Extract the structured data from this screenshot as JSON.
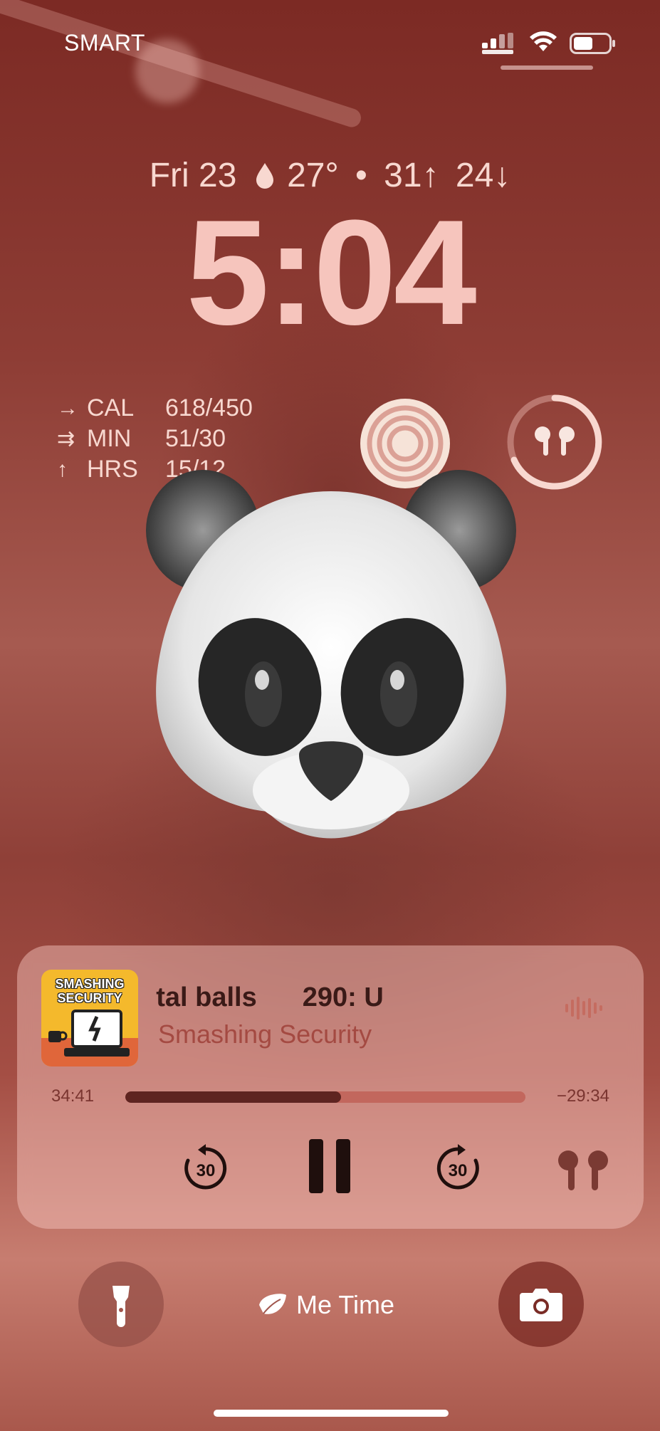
{
  "status_bar": {
    "carrier": "SMART"
  },
  "lockscreen": {
    "date": "Fri 23",
    "weather": {
      "temp": "27°",
      "separator": "•",
      "high": "31↑",
      "low": "24↓"
    },
    "time": "5:04"
  },
  "activity_widget": {
    "rows": [
      {
        "arrow": "→",
        "label": "CAL",
        "value": "618/450"
      },
      {
        "arrow": "⇉",
        "label": "MIN",
        "value": "51/30"
      },
      {
        "arrow": "↑",
        "label": "HRS",
        "value": "15/12"
      }
    ]
  },
  "now_playing": {
    "title": "ar, and crystal balls",
    "title_next": "290: U",
    "artist": "Smashing Security",
    "artwork_text": "SMASHING SECURITY",
    "elapsed": "34:41",
    "remaining": "−29:34",
    "progress_fraction": 0.54,
    "skip_back_seconds": "30",
    "skip_forward_seconds": "30"
  },
  "bottom": {
    "focus_label": "Me Time"
  },
  "colors": {
    "accent": "#f6c5bd",
    "player_bg": "#f0bdb5",
    "progress_fill": "#5e2420"
  }
}
